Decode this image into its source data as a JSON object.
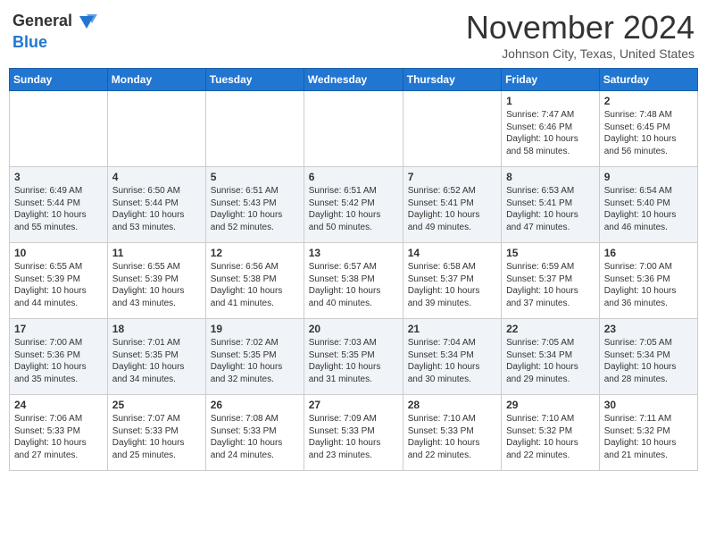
{
  "header": {
    "logo_line1": "General",
    "logo_line2": "Blue",
    "month_title": "November 2024",
    "location": "Johnson City, Texas, United States"
  },
  "days_of_week": [
    "Sunday",
    "Monday",
    "Tuesday",
    "Wednesday",
    "Thursday",
    "Friday",
    "Saturday"
  ],
  "weeks": [
    [
      {
        "day": "",
        "info": ""
      },
      {
        "day": "",
        "info": ""
      },
      {
        "day": "",
        "info": ""
      },
      {
        "day": "",
        "info": ""
      },
      {
        "day": "",
        "info": ""
      },
      {
        "day": "1",
        "info": "Sunrise: 7:47 AM\nSunset: 6:46 PM\nDaylight: 10 hours and 58 minutes."
      },
      {
        "day": "2",
        "info": "Sunrise: 7:48 AM\nSunset: 6:45 PM\nDaylight: 10 hours and 56 minutes."
      }
    ],
    [
      {
        "day": "3",
        "info": "Sunrise: 6:49 AM\nSunset: 5:44 PM\nDaylight: 10 hours and 55 minutes."
      },
      {
        "day": "4",
        "info": "Sunrise: 6:50 AM\nSunset: 5:44 PM\nDaylight: 10 hours and 53 minutes."
      },
      {
        "day": "5",
        "info": "Sunrise: 6:51 AM\nSunset: 5:43 PM\nDaylight: 10 hours and 52 minutes."
      },
      {
        "day": "6",
        "info": "Sunrise: 6:51 AM\nSunset: 5:42 PM\nDaylight: 10 hours and 50 minutes."
      },
      {
        "day": "7",
        "info": "Sunrise: 6:52 AM\nSunset: 5:41 PM\nDaylight: 10 hours and 49 minutes."
      },
      {
        "day": "8",
        "info": "Sunrise: 6:53 AM\nSunset: 5:41 PM\nDaylight: 10 hours and 47 minutes."
      },
      {
        "day": "9",
        "info": "Sunrise: 6:54 AM\nSunset: 5:40 PM\nDaylight: 10 hours and 46 minutes."
      }
    ],
    [
      {
        "day": "10",
        "info": "Sunrise: 6:55 AM\nSunset: 5:39 PM\nDaylight: 10 hours and 44 minutes."
      },
      {
        "day": "11",
        "info": "Sunrise: 6:55 AM\nSunset: 5:39 PM\nDaylight: 10 hours and 43 minutes."
      },
      {
        "day": "12",
        "info": "Sunrise: 6:56 AM\nSunset: 5:38 PM\nDaylight: 10 hours and 41 minutes."
      },
      {
        "day": "13",
        "info": "Sunrise: 6:57 AM\nSunset: 5:38 PM\nDaylight: 10 hours and 40 minutes."
      },
      {
        "day": "14",
        "info": "Sunrise: 6:58 AM\nSunset: 5:37 PM\nDaylight: 10 hours and 39 minutes."
      },
      {
        "day": "15",
        "info": "Sunrise: 6:59 AM\nSunset: 5:37 PM\nDaylight: 10 hours and 37 minutes."
      },
      {
        "day": "16",
        "info": "Sunrise: 7:00 AM\nSunset: 5:36 PM\nDaylight: 10 hours and 36 minutes."
      }
    ],
    [
      {
        "day": "17",
        "info": "Sunrise: 7:00 AM\nSunset: 5:36 PM\nDaylight: 10 hours and 35 minutes."
      },
      {
        "day": "18",
        "info": "Sunrise: 7:01 AM\nSunset: 5:35 PM\nDaylight: 10 hours and 34 minutes."
      },
      {
        "day": "19",
        "info": "Sunrise: 7:02 AM\nSunset: 5:35 PM\nDaylight: 10 hours and 32 minutes."
      },
      {
        "day": "20",
        "info": "Sunrise: 7:03 AM\nSunset: 5:35 PM\nDaylight: 10 hours and 31 minutes."
      },
      {
        "day": "21",
        "info": "Sunrise: 7:04 AM\nSunset: 5:34 PM\nDaylight: 10 hours and 30 minutes."
      },
      {
        "day": "22",
        "info": "Sunrise: 7:05 AM\nSunset: 5:34 PM\nDaylight: 10 hours and 29 minutes."
      },
      {
        "day": "23",
        "info": "Sunrise: 7:05 AM\nSunset: 5:34 PM\nDaylight: 10 hours and 28 minutes."
      }
    ],
    [
      {
        "day": "24",
        "info": "Sunrise: 7:06 AM\nSunset: 5:33 PM\nDaylight: 10 hours and 27 minutes."
      },
      {
        "day": "25",
        "info": "Sunrise: 7:07 AM\nSunset: 5:33 PM\nDaylight: 10 hours and 25 minutes."
      },
      {
        "day": "26",
        "info": "Sunrise: 7:08 AM\nSunset: 5:33 PM\nDaylight: 10 hours and 24 minutes."
      },
      {
        "day": "27",
        "info": "Sunrise: 7:09 AM\nSunset: 5:33 PM\nDaylight: 10 hours and 23 minutes."
      },
      {
        "day": "28",
        "info": "Sunrise: 7:10 AM\nSunset: 5:33 PM\nDaylight: 10 hours and 22 minutes."
      },
      {
        "day": "29",
        "info": "Sunrise: 7:10 AM\nSunset: 5:32 PM\nDaylight: 10 hours and 22 minutes."
      },
      {
        "day": "30",
        "info": "Sunrise: 7:11 AM\nSunset: 5:32 PM\nDaylight: 10 hours and 21 minutes."
      }
    ]
  ]
}
